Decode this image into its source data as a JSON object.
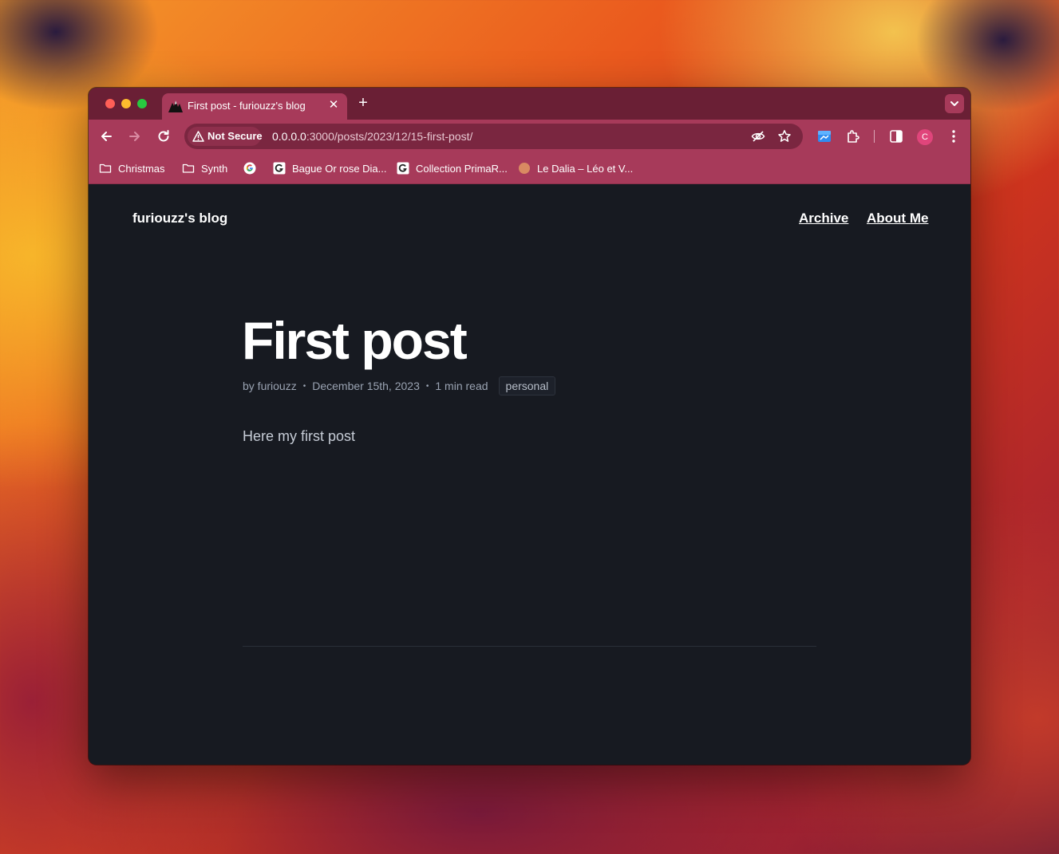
{
  "browser": {
    "tab": {
      "title": "First post - furiouzz's blog"
    },
    "new_tab_symbol": "+",
    "close_symbol": "✕",
    "omnibox": {
      "security_label": "Not Secure",
      "url_host": "0.0.0.0",
      "url_path": ":3000/posts/2023/12/15-first-post/"
    },
    "profile_initial": "C",
    "bookmarks": [
      {
        "label": "Christmas",
        "icon": "folder-icon"
      },
      {
        "label": "Synth",
        "icon": "folder-icon"
      },
      {
        "label": "",
        "icon": "google-icon"
      },
      {
        "label": "Bague Or rose Dia...",
        "icon": "site-icon"
      },
      {
        "label": "Collection PrimaR...",
        "icon": "site-icon"
      },
      {
        "label": "Le Dalia – Léo et V...",
        "icon": "circle-site-icon"
      }
    ],
    "colors": {
      "tab_strip": "#6a1f35",
      "toolbar": "#a73a5a",
      "page_bg": "#171a21"
    }
  },
  "site": {
    "title": "furiouzz's blog",
    "nav": {
      "archive": "Archive",
      "about": "About Me"
    }
  },
  "post": {
    "title": "First post",
    "author": "by furiouzz",
    "date": "December 15th, 2023",
    "read_time": "1 min read",
    "tag": "personal",
    "body": "Here my first post",
    "meta_separator": "•"
  }
}
